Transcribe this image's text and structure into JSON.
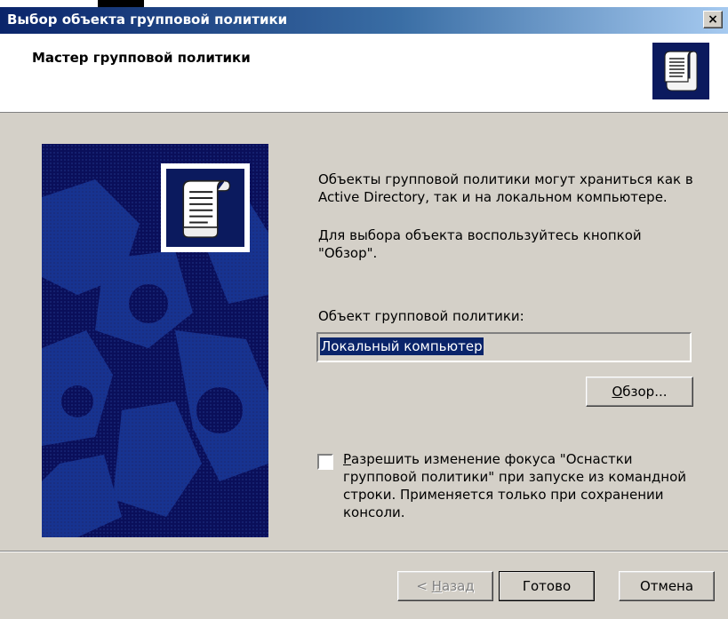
{
  "window": {
    "title": "Выбор объекта групповой политики",
    "close_glyph": "×"
  },
  "header": {
    "title": "Мастер групповой политики",
    "icon": "policy-scroll-icon"
  },
  "content": {
    "intro": "Объекты групповой политики могут храниться как в Active Directory, так и на локальном компьютере.",
    "hint": "Для выбора объекта воспользуйтесь кнопкой \"Обзор\".",
    "field_label": "Объект групповой политики:",
    "field_value": "Локальный компьютер",
    "browse_button": {
      "accel": "О",
      "rest": "бзор..."
    },
    "checkbox": {
      "checked": false,
      "accel": "Р",
      "rest": "азрешить изменение фокуса \"Оснастки групповой политики\" при запуске из командной строки. Применяется только при сохранении консоли."
    }
  },
  "footer": {
    "back_button": {
      "prefix": "< ",
      "accel": "Н",
      "rest": "азад"
    },
    "finish_button": "Готово",
    "cancel_button": "Отмена"
  },
  "colors": {
    "title_bar": "#0a246a",
    "face": "#d4d0c8",
    "side_panel": "#0a0f5a",
    "selection": "#0a246a"
  }
}
